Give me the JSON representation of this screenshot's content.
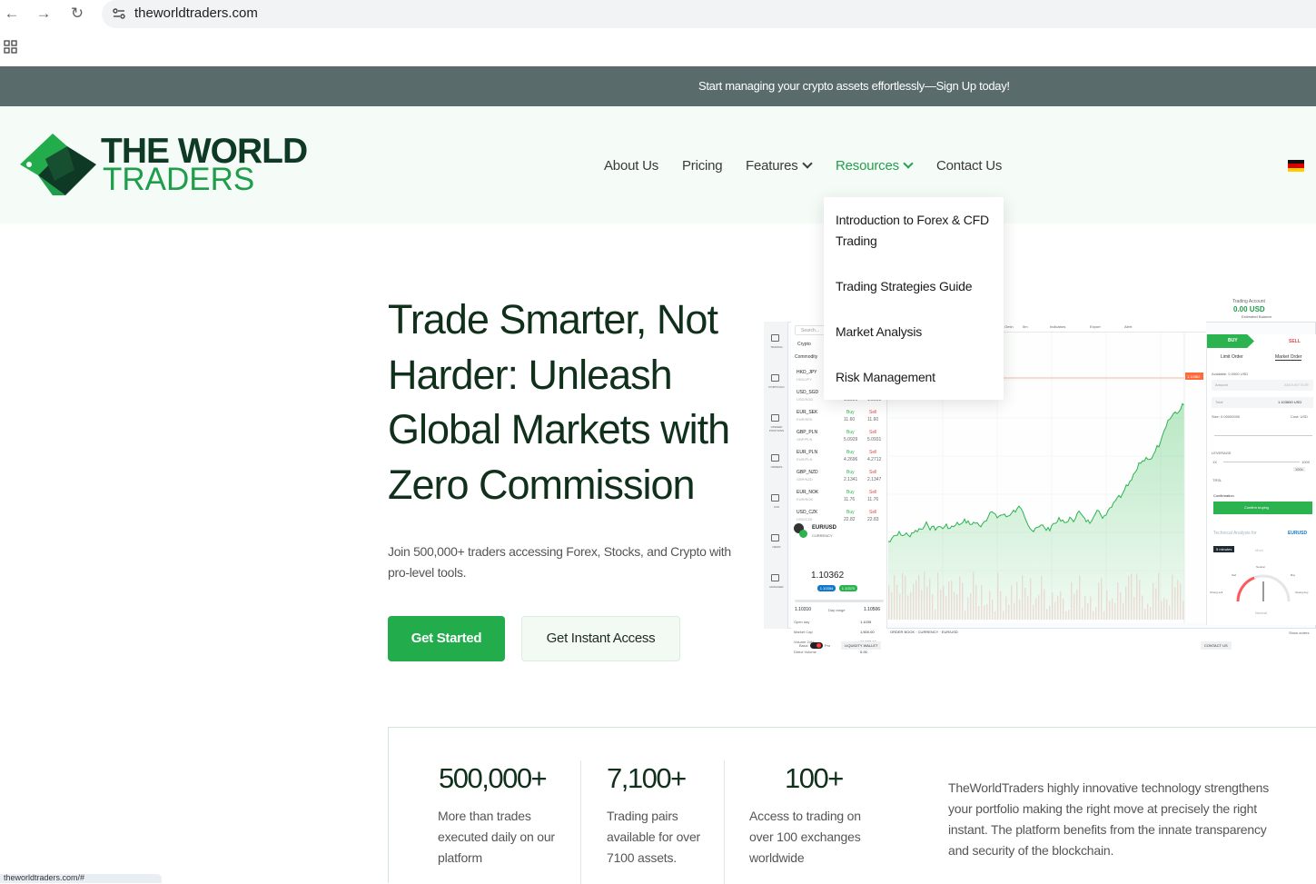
{
  "browser": {
    "url": "theworldtraders.com",
    "status_url": "theworldtraders.com/#"
  },
  "banner": {
    "text": "Start managing your crypto assets effortlessly—Sign Up today!"
  },
  "logo": {
    "line1": "THE WORLD",
    "line2": "TRADERS"
  },
  "nav": {
    "about": "About Us",
    "pricing": "Pricing",
    "features": "Features",
    "resources": "Resources",
    "contact": "Contact Us"
  },
  "resources_menu": [
    "Introduction to Forex & CFD Trading",
    "Trading Strategies Guide",
    "Market Analysis",
    "Risk Management"
  ],
  "hero": {
    "title": "Trade Smarter, Not Harder: Unleash Global Markets with Zero Commission",
    "subtitle": "Join 500,000+ traders accessing Forex, Stocks, and Crypto with pro-level tools.",
    "cta_primary": "Get Started",
    "cta_secondary": "Get Instant Access"
  },
  "platform": {
    "search": "Search...",
    "tabs": [
      "Crypto",
      "Commodity"
    ],
    "pairs": [
      {
        "name": "HKD_JPY",
        "sub": "HKD/JPY",
        "buy": "",
        "sell": ""
      },
      {
        "name": "USD_SGD",
        "sub": "USD/SGD",
        "buy": "1.3506",
        "sell": "1.3508"
      },
      {
        "name": "EUR_SEK",
        "sub": "EUR/SEK",
        "buy": "11.60",
        "sell": "11.60"
      },
      {
        "name": "GBP_PLN",
        "sub": "GBP/PLN",
        "buy": "5.0929",
        "sell": "5.0931"
      },
      {
        "name": "EUR_PLN",
        "sub": "EUR/PLN",
        "buy": "4.2696",
        "sell": "4.2712"
      },
      {
        "name": "GBP_NZD",
        "sub": "GBP/NZD",
        "buy": "2.1341",
        "sell": "2.1347"
      },
      {
        "name": "EUR_NOK",
        "sub": "EUR/NOK",
        "buy": "11.76",
        "sell": "11.76"
      },
      {
        "name": "USD_CZK",
        "sub": "USD/CZK",
        "buy": "22.82",
        "sell": "22.83"
      }
    ],
    "buy_label": "Buy",
    "sell_label": "Sell",
    "selected_pair": "EUR/USD",
    "selected_sub": "CURRENCY",
    "price": "1.10362",
    "bid": "1.10354",
    "ask": "1.10370",
    "range_low": "1.10310",
    "range_label": "Day range",
    "range_high": "1.10506",
    "stats": [
      {
        "label": "Open day",
        "value": "1.1039"
      },
      {
        "label": "Market Cap",
        "value": "1,500.00"
      },
      {
        "label": "Volume 24H",
        "value": "13,337.00"
      },
      {
        "label": "Direct Volume",
        "value": "0.00"
      }
    ],
    "sidebar_icons": [
      "TRADING",
      "PORTFOLIO",
      "OPENED POSITIONS",
      "ORDERS",
      "CFD",
      "NEWS",
      "MANAGER"
    ],
    "account_label": "Trading Account",
    "account_value": "0.00 USD",
    "account_sub": "Estimated Balance",
    "toolbar": [
      "Omin",
      "5m",
      "Indicators",
      "Export",
      "Alert"
    ],
    "order": {
      "buy": "BUY",
      "sell": "SELL",
      "limit": "Limit Order",
      "market": "Market Order",
      "available": "Available: 0.0000 USD",
      "amount": "Amount",
      "amount_unit": "AMOUNT EUR",
      "total": "Total",
      "total_value": "1.103650 USD",
      "size": "Size: 0.00000000",
      "cost": "Cost: USD",
      "leverage": "LEVERAGE",
      "lev_min": "1X",
      "lev_max": "100X",
      "lev_value": "100x",
      "trsl": "TRSL",
      "confirmation": "Confirmation",
      "confirm_btn": "Confirm buying",
      "ta_title": "Technical Analysis for",
      "ta_pair": "EURUSD",
      "interval": "5 minutes",
      "interval_more": "More",
      "gauge_neutral_top": "Neutral",
      "gauge_sell": "Sell",
      "gauge_buy": "Buy",
      "gauge_strong_sell": "Strong sell",
      "gauge_strong_buy": "Strong buy",
      "gauge_neutral": "Neutral"
    },
    "chart_price_tag": "1.10362",
    "bottom_tabs": "ORDER BOOK · CURRENCY · EUR/USD",
    "liquidity": "LIQUIDITY WALLET",
    "contact_btn": "CONTACT US",
    "show_orders": "Show orders",
    "toggle_left": "Basic",
    "toggle_right": "Pro"
  },
  "stats": [
    {
      "number": "500,000+",
      "text": "More than trades executed daily on our platform"
    },
    {
      "number": "7,100+",
      "text": "Trading pairs available for over 7100 assets."
    },
    {
      "number": "100+",
      "text": "Access to trading on over 100 exchanges worldwide"
    }
  ],
  "stats_description": "TheWorldTraders highly innovative technology strengthens your portfolio making the right move at precisely the right instant. The platform benefits from the innate transparency and security of the blockchain.",
  "colors": {
    "brand_green": "#22ac4c",
    "brand_dark": "#0e3a25",
    "banner_bg": "#5a6b6b",
    "header_bg": "#f5fbf6"
  }
}
